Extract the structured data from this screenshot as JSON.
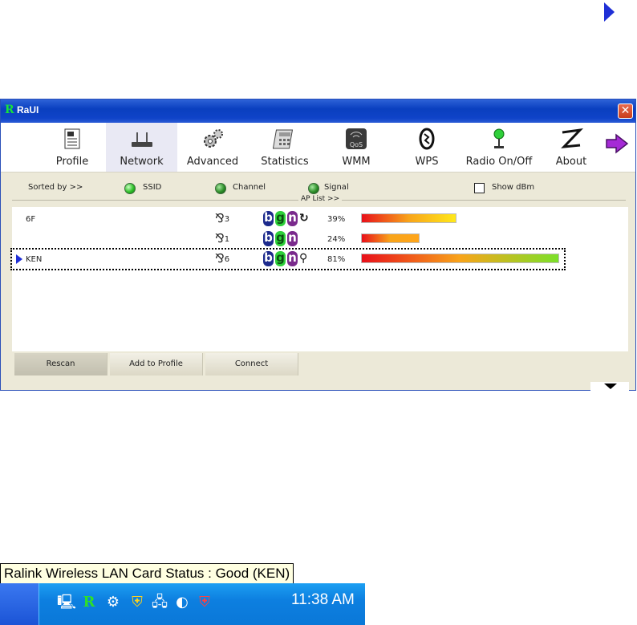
{
  "window": {
    "title": "RaUI",
    "logo_glyph": "R",
    "close_glyph": "✕"
  },
  "toolbar": {
    "items": [
      {
        "label": "Profile",
        "icon": "profile-icon"
      },
      {
        "label": "Network",
        "icon": "network-icon",
        "active": true
      },
      {
        "label": "Advanced",
        "icon": "gears-icon"
      },
      {
        "label": "Statistics",
        "icon": "calculator-icon"
      },
      {
        "label": "WMM",
        "icon": "qos-icon"
      },
      {
        "label": "WPS",
        "icon": "wps-icon"
      },
      {
        "label": "Radio On/Off",
        "icon": "radio-icon"
      },
      {
        "label": "About",
        "icon": "about-icon"
      }
    ]
  },
  "sort": {
    "label": "Sorted by >>",
    "options": [
      "SSID",
      "Channel",
      "Signal"
    ],
    "show_dbm": "Show dBm",
    "aplist": "AP List >>"
  },
  "ap_list": [
    {
      "ssid": "6F",
      "channel": "3",
      "badges": [
        "b",
        "g",
        "n"
      ],
      "extra": "wps",
      "signal": "39%",
      "signal_fraction": 0.39
    },
    {
      "ssid": "",
      "channel": "1",
      "badges": [
        "b",
        "g",
        "n"
      ],
      "extra": "",
      "signal": "24%",
      "signal_fraction": 0.24
    },
    {
      "ssid": "KEN",
      "channel": "6",
      "badges": [
        "b",
        "g",
        "n"
      ],
      "extra": "key",
      "signal": "81%",
      "signal_fraction": 0.81,
      "selected": true
    }
  ],
  "buttons": {
    "rescan": "Rescan",
    "add_profile": "Add to Profile",
    "connect": "Connect"
  },
  "taskbar": {
    "tooltip": "Ralink Wireless LAN Card Status : Good (KEN)",
    "time": "11:38 AM"
  }
}
